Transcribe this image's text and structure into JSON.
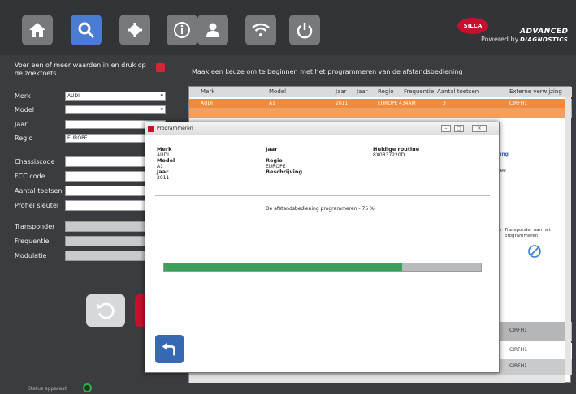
{
  "topbar": {
    "buttons": [
      "home-icon",
      "search-icon",
      "gear-icon",
      "info-icon",
      "user-icon",
      "wifi-icon",
      "power-icon"
    ],
    "powered_by": "Powered by",
    "brand_line1": "ADVANCED",
    "brand_line2": "DIAGNOSTICS",
    "silca": "SILCA"
  },
  "left": {
    "prompt": "Voer een of meer waarden in en druk op de zoektoets",
    "fields": [
      {
        "label": "Merk",
        "value": "AUDI"
      },
      {
        "label": "Model",
        "value": ""
      },
      {
        "label": "Jaar",
        "value": ""
      },
      {
        "label": "Regio",
        "value": "EUROPE"
      },
      {
        "label": "Chassiscode",
        "value": ""
      },
      {
        "label": "FCC code",
        "value": ""
      },
      {
        "label": "Aantal toetsen",
        "value": ""
      },
      {
        "label": "Profiel sleutel",
        "value": ""
      },
      {
        "label": "Transponder",
        "value": ""
      },
      {
        "label": "Frequentie",
        "value": ""
      },
      {
        "label": "Modulatie",
        "value": ""
      }
    ]
  },
  "main": {
    "title": "Maak een keuze om te beginnen met het programmeren van de afstandsbediening",
    "headers": [
      "Merk",
      "Model",
      "Jaar",
      "Jaar",
      "Regio",
      "Frequentie",
      "Aantal toetsen",
      "Externe verwijzing"
    ],
    "row1": [
      "AUDI",
      "A1",
      "2011",
      "",
      "EUROPE",
      "434AM",
      "3",
      "CIRFH1"
    ],
    "side_text1": "ning",
    "side_text2": "Nee",
    "transponder_header_a": "pp",
    "transponder_header_b": "Transponder aan het programmeren",
    "cirfh_rows": [
      "CIRFH1",
      "CIRFH1",
      "CIRFH1"
    ]
  },
  "dialog": {
    "title": "Programmeren",
    "merk_label": "Merk",
    "merk_value": "AUDI",
    "model_label": "Model",
    "model_value": "A1",
    "jaar_label": "Jaar",
    "jaar_value": "2011",
    "jaar2_label": "Jaar",
    "regio_label": "Regio",
    "regio_value": "EUROPE",
    "beschrijving_label": "Beschrijving",
    "routine_label": "Huidige routine",
    "routine_value": "8X0837220D",
    "progress_text": "De afstandsbediening programmeren - 75 %",
    "progress": 0.75
  },
  "status": {
    "label": "Status apparaat"
  }
}
